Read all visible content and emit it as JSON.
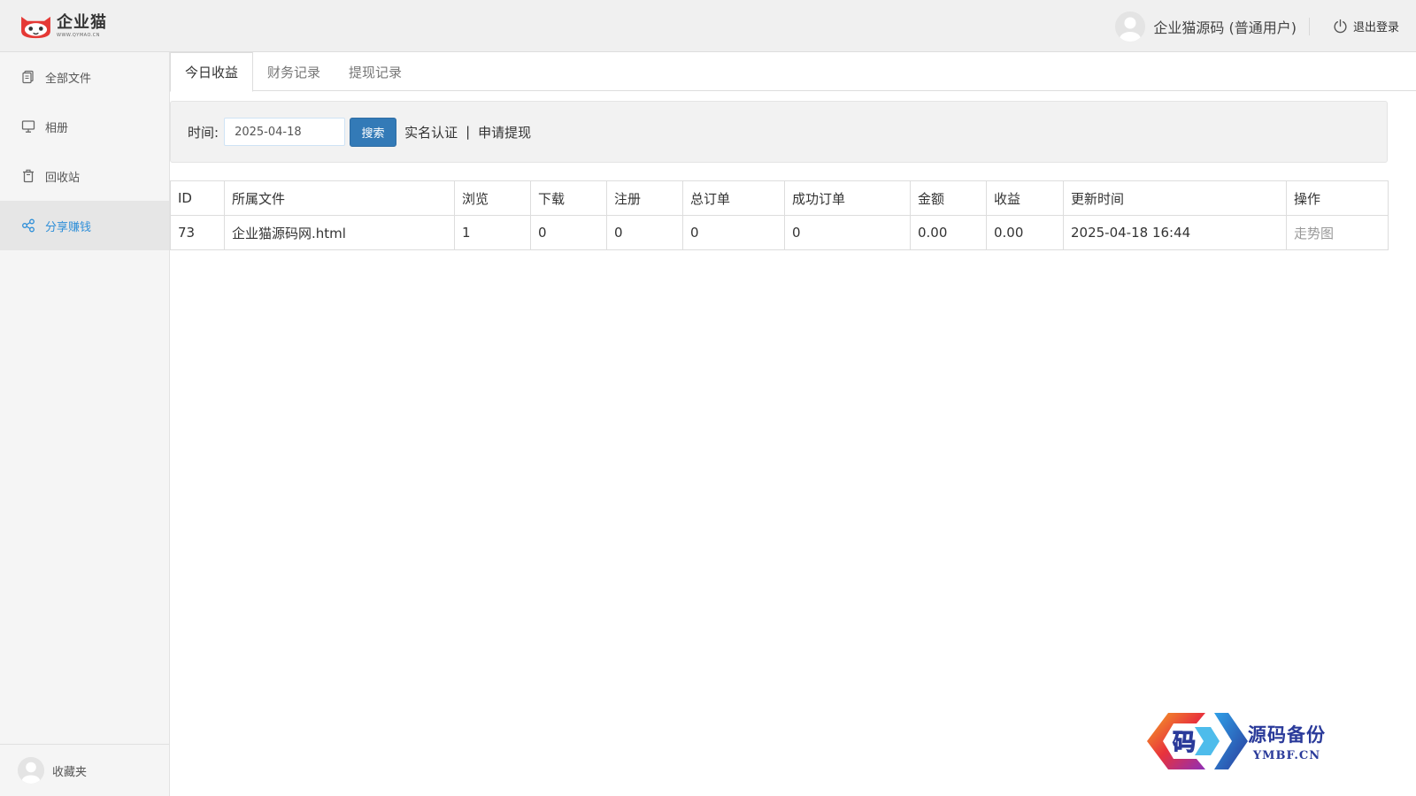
{
  "header": {
    "logo_name": "企业猫",
    "logo_url": "WWW.QYMAO.CN",
    "user_name": "企业猫源码 (普通用户)",
    "logout_label": "退出登录"
  },
  "sidebar": {
    "items": [
      {
        "label": "全部文件",
        "icon": "files-icon"
      },
      {
        "label": "相册",
        "icon": "monitor-icon"
      },
      {
        "label": "回收站",
        "icon": "trash-icon"
      },
      {
        "label": "分享赚钱",
        "icon": "share-icon",
        "active": true
      }
    ],
    "favorites_label": "收藏夹"
  },
  "tabs": [
    {
      "label": "今日收益",
      "active": true
    },
    {
      "label": "财务记录"
    },
    {
      "label": "提现记录"
    }
  ],
  "search": {
    "time_label": "时间:",
    "date_value": "2025-04-18",
    "button_label": "搜索",
    "verify_link": "实名认证",
    "separator": "|",
    "withdraw_link": "申请提现"
  },
  "table": {
    "columns": [
      "ID",
      "所属文件",
      "浏览",
      "下载",
      "注册",
      "总订单",
      "成功订单",
      "金额",
      "收益",
      "更新时间",
      "操作"
    ],
    "rows": [
      [
        "73",
        "企业猫源码网.html",
        "1",
        "0",
        "0",
        "0",
        "0",
        "0.00",
        "0.00",
        "2025-04-18 16:44",
        "走势图"
      ]
    ]
  },
  "watermark": {
    "glyph": "码",
    "cn": "源码备份",
    "en": "YMBF.CN"
  },
  "colors": {
    "accent": "#2d8ed8",
    "button": "#337ab7",
    "header_bg": "#f0f0f0",
    "sidebar_bg": "#f5f5f5"
  }
}
